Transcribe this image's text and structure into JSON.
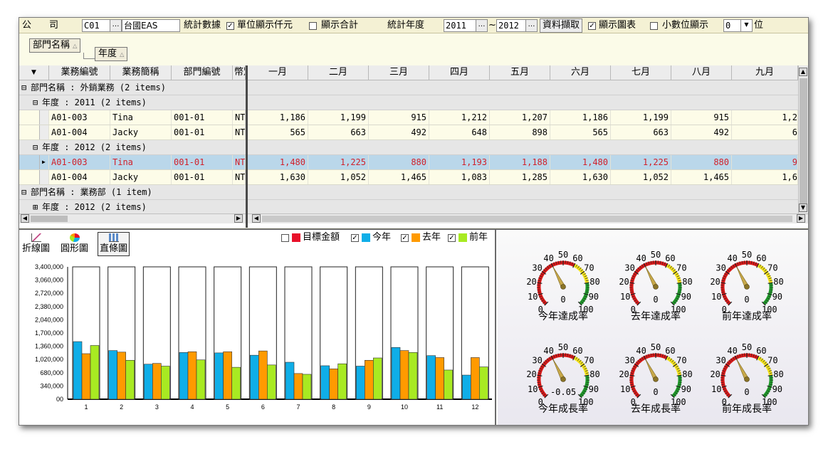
{
  "toolbar": {
    "company_label": "公　司",
    "company_code": "C01",
    "company_name": "台國EAS",
    "stats_label": "統計數據",
    "unit_label": "單位顯示仟元",
    "unit_checked": true,
    "show_total_label": "顯示合計",
    "show_total_checked": false,
    "year_label": "統計年度",
    "year_from": "2011",
    "year_sep": "~",
    "year_to": "2012",
    "fetch_label": "資料擷取",
    "show_chart_label": "顯示圖表",
    "show_chart_checked": true,
    "decimal_label": "小數位顯示",
    "decimal_checked": false,
    "decimal_value": "0",
    "decimal_unit": "位",
    "ellipsis": "…",
    "dropdown_arrow": "▼"
  },
  "group_panel": {
    "chips": [
      "部門名稱",
      "年度"
    ],
    "sort_icon": "sort-asc-icon"
  },
  "grid": {
    "headers": [
      "業務編號",
      "業務簡稱",
      "部門編號",
      "幣別",
      "一月",
      "二月",
      "三月",
      "四月",
      "五月",
      "六月",
      "七月",
      "八月",
      "九月"
    ],
    "rows": [
      {
        "type": "group",
        "indent": 0,
        "toggle": "⊟",
        "text": "部門名稱 : 外銷業務 (2 items)"
      },
      {
        "type": "group",
        "indent": 1,
        "toggle": "⊟",
        "text": "年度 : 2011 (2 items)"
      },
      {
        "type": "data",
        "selected": false,
        "code": "A01-003",
        "name": "Tina",
        "dept": "001-01",
        "cur": "NT",
        "values": [
          "1,186",
          "1,199",
          "915",
          "1,212",
          "1,207",
          "1,186",
          "1,199",
          "915",
          "1,2"
        ]
      },
      {
        "type": "data",
        "selected": false,
        "code": "A01-004",
        "name": "Jacky",
        "dept": "001-01",
        "cur": "NT",
        "values": [
          "565",
          "663",
          "492",
          "648",
          "898",
          "565",
          "663",
          "492",
          "6"
        ]
      },
      {
        "type": "group",
        "indent": 1,
        "toggle": "⊟",
        "text": "年度 : 2012 (2 items)"
      },
      {
        "type": "data",
        "selected": true,
        "code": "A01-003",
        "name": "Tina",
        "dept": "001-01",
        "cur": "NT",
        "values": [
          "1,480",
          "1,225",
          "880",
          "1,193",
          "1,188",
          "1,480",
          "1,225",
          "880",
          "9"
        ]
      },
      {
        "type": "data",
        "selected": false,
        "code": "A01-004",
        "name": "Jacky",
        "dept": "001-01",
        "cur": "NT",
        "values": [
          "1,630",
          "1,052",
          "1,465",
          "1,083",
          "1,285",
          "1,630",
          "1,052",
          "1,465",
          "1,6"
        ]
      },
      {
        "type": "group",
        "indent": 0,
        "toggle": "⊟",
        "text": "部門名稱 : 業務部 (1 item)"
      },
      {
        "type": "group",
        "indent": 1,
        "toggle": "⊞",
        "text": "年度 : 2012 (2 items)"
      }
    ]
  },
  "chart_tabs": [
    {
      "label": "折線圖",
      "icon": "line-chart-icon",
      "active": false
    },
    {
      "label": "圓形圖",
      "icon": "pie-chart-icon",
      "active": false
    },
    {
      "label": "直條圖",
      "icon": "bar-chart-icon",
      "active": true
    }
  ],
  "chart_data": {
    "type": "bar",
    "categories": [
      "1",
      "2",
      "3",
      "4",
      "5",
      "6",
      "7",
      "8",
      "9",
      "10",
      "11",
      "12"
    ],
    "ylim": [
      0,
      3400000
    ],
    "yticks": [
      "3,400,000",
      "3,060,000",
      "2,720,000",
      "2,380,000",
      "2,040,000",
      "1,700,000",
      "1,360,000",
      "1,020,000",
      "680,000",
      "340,000",
      "00"
    ],
    "series": [
      {
        "name": "目標金額",
        "enabled": false,
        "color": "#e8102a",
        "values": [
          3400000,
          3400000,
          3400000,
          3400000,
          3400000,
          3400000,
          3400000,
          3400000,
          3400000,
          3400000,
          3400000,
          3400000
        ]
      },
      {
        "name": "今年",
        "enabled": true,
        "color": "#0faee8",
        "values": [
          1480000,
          1250000,
          900000,
          1200000,
          1190000,
          1130000,
          950000,
          860000,
          850000,
          1330000,
          1120000,
          620000
        ]
      },
      {
        "name": "去年",
        "enabled": true,
        "color": "#ff9a00",
        "values": [
          1170000,
          1210000,
          920000,
          1220000,
          1220000,
          1240000,
          660000,
          780000,
          1000000,
          1250000,
          1070000,
          1070000
        ]
      },
      {
        "name": "前年",
        "enabled": true,
        "color": "#a8ea22",
        "values": [
          1380000,
          1000000,
          850000,
          1010000,
          820000,
          880000,
          640000,
          910000,
          1060000,
          1200000,
          750000,
          830000
        ]
      }
    ],
    "legend_position": "top-right"
  },
  "gauges": [
    {
      "label": "今年達成率",
      "value": 40,
      "readout": "0",
      "ticks": [
        "0",
        "10",
        "20",
        "30",
        "40",
        "50",
        "60",
        "70",
        "80",
        "90",
        "100"
      ]
    },
    {
      "label": "去年達成率",
      "value": 40,
      "readout": "0",
      "ticks": [
        "0",
        "10",
        "20",
        "30",
        "40",
        "50",
        "60",
        "70",
        "80",
        "90",
        "100"
      ]
    },
    {
      "label": "前年達成率",
      "value": 40,
      "readout": "0",
      "ticks": [
        "0",
        "10",
        "20",
        "30",
        "40",
        "50",
        "60",
        "70",
        "80",
        "90",
        "100"
      ]
    },
    {
      "label": "今年成長率",
      "value": 40,
      "readout": "-0.05",
      "ticks": [
        "0",
        "10",
        "20",
        "30",
        "40",
        "50",
        "60",
        "70",
        "80",
        "90",
        "100"
      ]
    },
    {
      "label": "去年成長率",
      "value": 40,
      "readout": "0",
      "ticks": [
        "0",
        "10",
        "20",
        "30",
        "40",
        "50",
        "60",
        "70",
        "80",
        "90",
        "100"
      ]
    },
    {
      "label": "前年成長率",
      "value": 40,
      "readout": "0",
      "ticks": [
        "0",
        "10",
        "20",
        "30",
        "40",
        "50",
        "60",
        "70",
        "80",
        "90",
        "100"
      ]
    }
  ]
}
